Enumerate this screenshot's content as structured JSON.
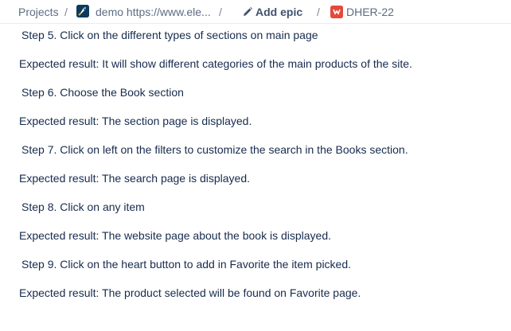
{
  "breadcrumb": {
    "projects": "Projects",
    "separator": "/",
    "project_name": "demo https://www.ele...",
    "project_icon": "rocket-icon",
    "add_epic": "Add epic",
    "add_epic_icon": "pencil-icon",
    "issue_icon": "bug-icon",
    "issue_key": "DHER-22",
    "colors": {
      "text": "#5e6c84",
      "project_icon_bg": "#0c3b5e",
      "issue_icon_bg": "#e5493a"
    }
  },
  "content": {
    "lines": [
      "Step 5. Click on the different types of sections on main page",
      "Expected result: It will show different categories of the main products of the site.",
      "Step 6. Choose the Book section",
      "Expected result: The section page is displayed.",
      "Step 7. Click on left on the filters to customize the search in the Books section.",
      "Expected result: The search page is displayed.",
      "Step 8. Click on any item",
      "Expected result: The website page about the book is displayed.",
      "Step 9. Click on the heart button to add in Favorite the item picked.",
      "Expected result: The product selected will be found on Favorite page."
    ]
  }
}
